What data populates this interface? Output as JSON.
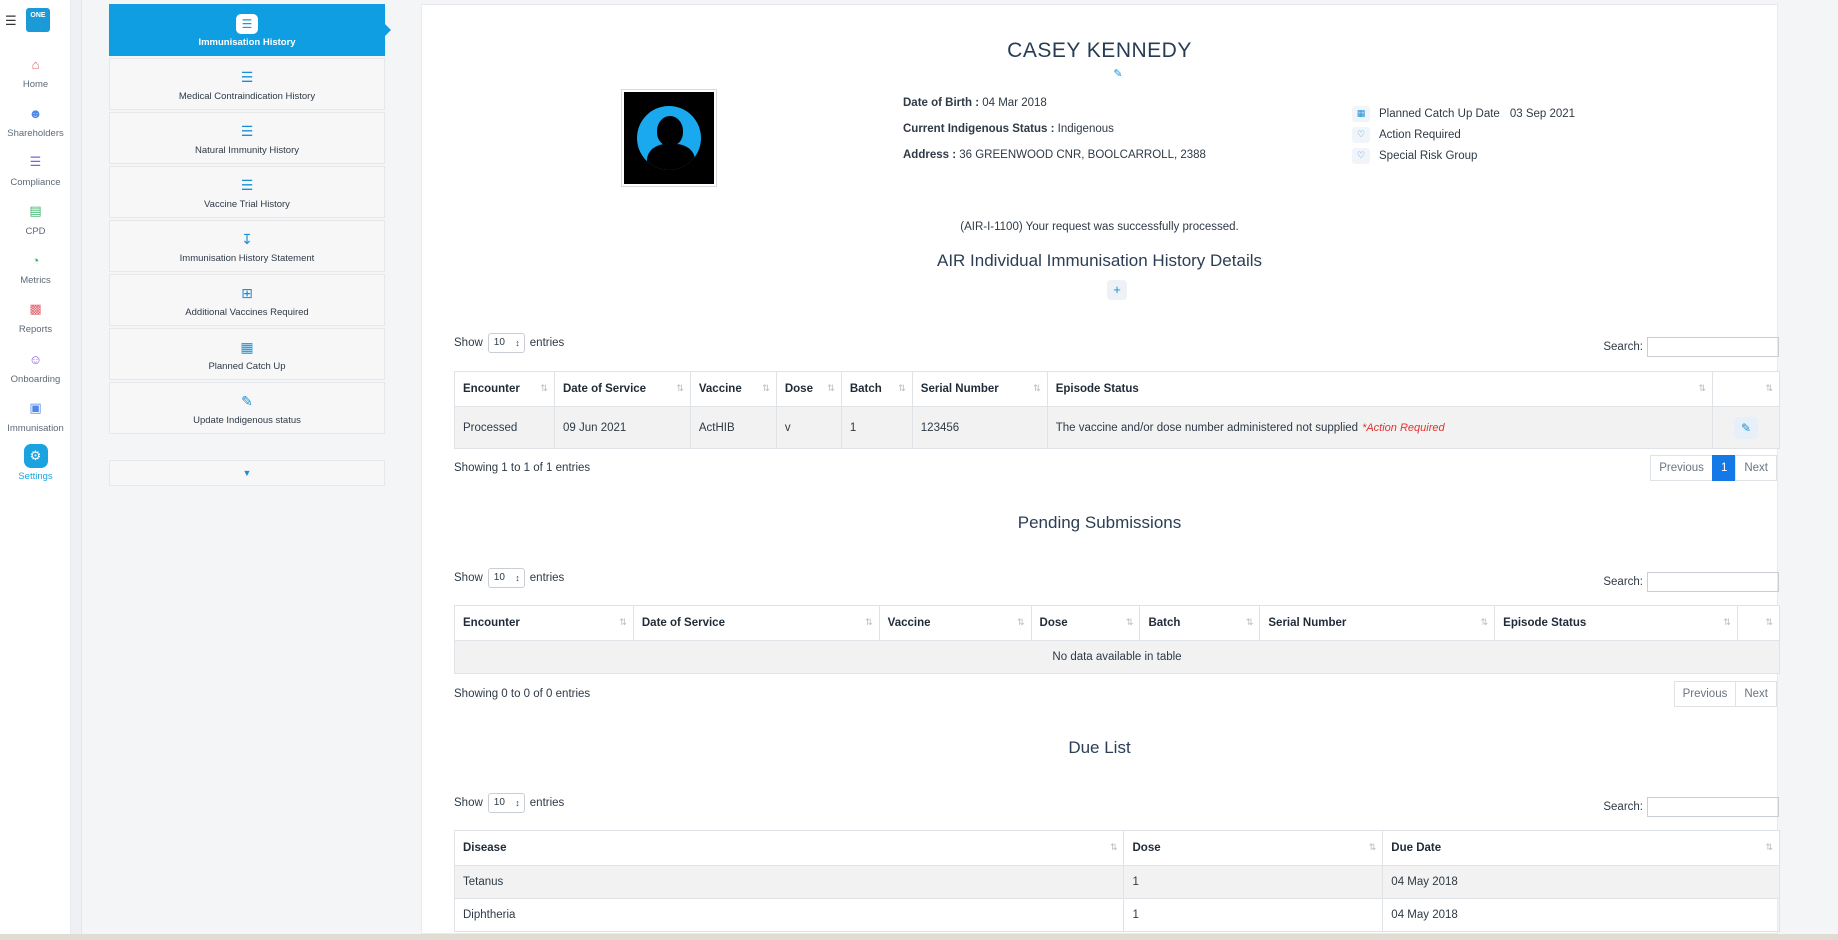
{
  "rail": {
    "logo": "ONE",
    "items": [
      {
        "label": "Home",
        "icon": "home-icon",
        "color": "#e35d6a"
      },
      {
        "label": "Shareholders",
        "icon": "users-icon",
        "color": "#4f86e8"
      },
      {
        "label": "Compliance",
        "icon": "list-icon",
        "color": "#8a5de0"
      },
      {
        "label": "CPD",
        "icon": "clipboard-icon",
        "color": "#3bb56c"
      },
      {
        "label": "Metrics",
        "icon": "pie-chart-icon",
        "color": "#3bb56c"
      },
      {
        "label": "Reports",
        "icon": "file-icon",
        "color": "#e35d6a"
      },
      {
        "label": "Onboarding",
        "icon": "user-plus-icon",
        "color": "#8a5de0"
      },
      {
        "label": "Immunisation",
        "icon": "monitor-icon",
        "color": "#4f86e8"
      },
      {
        "label": "Settings",
        "icon": "gear-icon",
        "color": "#1aa3e0"
      }
    ]
  },
  "menu": {
    "items": [
      {
        "label": "Immunisation History",
        "icon": "list-icon"
      },
      {
        "label": "Medical Contraindication History",
        "icon": "list-icon"
      },
      {
        "label": "Natural Immunity History",
        "icon": "list-icon"
      },
      {
        "label": "Vaccine Trial History",
        "icon": "list-icon"
      },
      {
        "label": "Immunisation History Statement",
        "icon": "download-icon"
      },
      {
        "label": "Additional Vaccines Required",
        "icon": "plus-square-icon"
      },
      {
        "label": "Planned Catch Up",
        "icon": "calendar-plus-icon"
      },
      {
        "label": "Update Indigenous status",
        "icon": "pencil-icon"
      }
    ]
  },
  "patient": {
    "name": "CASEY KENNEDY",
    "dob_label": "Date of Birth :",
    "dob": "04 Mar 2018",
    "indigenous_label": "Current Indigenous Status :",
    "indigenous": "Indigenous",
    "address_label": "Address :",
    "address": "36 GREENWOOD CNR, BOOLCARROLL, 2388"
  },
  "flags": {
    "catchup_label": "Planned Catch Up Date",
    "catchup_date": "03 Sep 2021",
    "action_required": "Action Required",
    "special_risk": "Special Risk Group"
  },
  "success_message": "(AIR-I-1100) Your request was successfully processed.",
  "history": {
    "title": "AIR Individual Immunisation History Details",
    "show_label": "Show",
    "entries_label": "entries",
    "page_size": "10",
    "search_label": "Search:",
    "columns": [
      "Encounter",
      "Date of Service",
      "Vaccine",
      "Dose",
      "Batch",
      "Serial Number",
      "Episode Status",
      ""
    ],
    "rows": [
      {
        "encounter": "Processed",
        "date": "09 Jun 2021",
        "vaccine": "ActHIB",
        "dose": "v",
        "batch": "1",
        "serial": "123456",
        "status": "The vaccine and/or dose number administered not supplied",
        "flag": "*Action Required"
      }
    ],
    "info": "Showing 1 to 1 of 1 entries",
    "prev": "Previous",
    "page": "1",
    "next": "Next"
  },
  "pending": {
    "title": "Pending Submissions",
    "show_label": "Show",
    "entries_label": "entries",
    "page_size": "10",
    "search_label": "Search:",
    "columns": [
      "Encounter",
      "Date of Service",
      "Vaccine",
      "Dose",
      "Batch",
      "Serial Number",
      "Episode Status",
      ""
    ],
    "empty": "No data available in table",
    "info": "Showing 0 to 0 of 0 entries",
    "prev": "Previous",
    "next": "Next"
  },
  "due": {
    "title": "Due List",
    "show_label": "Show",
    "entries_label": "entries",
    "page_size": "10",
    "search_label": "Search:",
    "columns": [
      "Disease",
      "Dose",
      "Due Date"
    ],
    "rows": [
      {
        "disease": "Tetanus",
        "dose": "1",
        "due": "04 May 2018"
      },
      {
        "disease": "Diphtheria",
        "dose": "1",
        "due": "04 May 2018"
      }
    ]
  }
}
